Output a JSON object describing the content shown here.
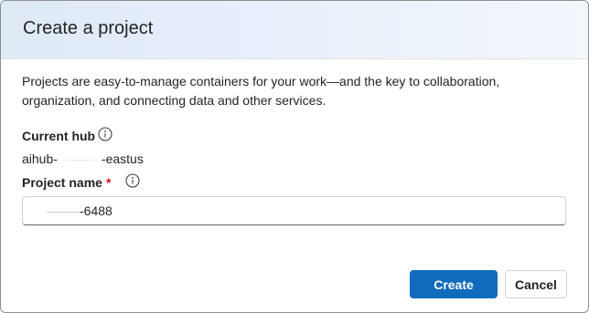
{
  "dialog": {
    "title": "Create a project",
    "description": "Projects are easy-to-manage containers for your work—and the key to collaboration, organization, and connecting data and other services."
  },
  "current_hub": {
    "label": "Current hub",
    "value_prefix": "aihub-",
    "value_suffix": "-eastus"
  },
  "project_name": {
    "label": "Project name",
    "required_marker": "*",
    "value_suffix": "-6488"
  },
  "buttons": {
    "create_label": "Create",
    "cancel_label": "Cancel"
  },
  "colors": {
    "primary": "#0f6cbd",
    "required": "#c50f1f",
    "header_gradient_start": "#dfeaf7"
  },
  "icons": {
    "info": "info-icon"
  }
}
